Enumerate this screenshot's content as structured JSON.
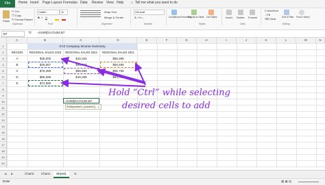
{
  "ribbon_tabs": [
    "File",
    "Home",
    "Insert",
    "Page Layout",
    "Formulas",
    "Data",
    "Review",
    "View",
    "Help"
  ],
  "tell_me": "Tell me what you want to do",
  "clipboard": {
    "cut": "Cut",
    "copy": "Copy",
    "format_painter": "Format Painter",
    "paste": "Paste",
    "label": "Clipboard"
  },
  "font": {
    "name": "Calibri",
    "size": "11",
    "label": "Font"
  },
  "alignment": {
    "wrap": "Wrap Text",
    "merge": "Merge & Center",
    "label": "Alignment"
  },
  "number": {
    "format": "General",
    "label": "Number"
  },
  "styles": {
    "conditional": "Conditional Formatting",
    "format_table": "Format as Table",
    "cell_styles": "Cell Styles",
    "label": "Styles"
  },
  "cells": {
    "insert": "Insert",
    "delete": "Delete",
    "format": "Format",
    "label": "Cells"
  },
  "editing": {
    "autosum": "AutoSum",
    "fill": "Fill",
    "clear": "Clear",
    "sort": "Sort & Filter",
    "find": "Find & Select",
    "label": "Editing"
  },
  "namebox": "B7",
  "fx": "fx",
  "formula": "=SUM(D4,C5,B4,B7",
  "columns": [
    "A",
    "B",
    "C",
    "D",
    "E",
    "F",
    "G",
    "H",
    "I",
    "J",
    "K",
    "L",
    "M",
    "N"
  ],
  "rows": [
    "1",
    "2",
    "3",
    "4",
    "5",
    "6",
    "7",
    "8",
    "9",
    "10",
    "11",
    "12",
    "13",
    "14",
    "15",
    "16",
    "17",
    "18",
    "19",
    "20"
  ],
  "sheet_title": "XYZ Company Income Summary",
  "headers": {
    "region": "REGION",
    "s2023": "REGIONAL SALES 2023",
    "s2022": "REGIONAL SALES 2022",
    "s2021": "REGIONAL SALES 2021"
  },
  "table": [
    {
      "region": "A",
      "s2023": "$35,000",
      "s2022": "$15,325",
      "s2021": "$56,389"
    },
    {
      "region": "B",
      "s2023": "$25,657",
      "s2022": "$98,458",
      "s2021": "$65,598"
    },
    {
      "region": "C",
      "s2023": "$78,458",
      "s2022": "$85,698",
      "s2021": "$85,785"
    },
    {
      "region": "D",
      "s2023": "$55,698",
      "s2022": "$16,258",
      "s2021": "$54,787"
    },
    {
      "region": "E",
      "s2023": "$74,589",
      "s2022": "",
      "s2021": ""
    }
  ],
  "active_formula": "=SUM(D4,C5,B4,B7",
  "tooltip": "SUM(number1, [number2], ...)",
  "callout_line1": "Hold “Ctrl” while selecting",
  "callout_line2": "desired cells to add",
  "sheet_tabs": [
    "Chart2",
    "Chart1",
    "Sheet1"
  ],
  "status": "Enter"
}
